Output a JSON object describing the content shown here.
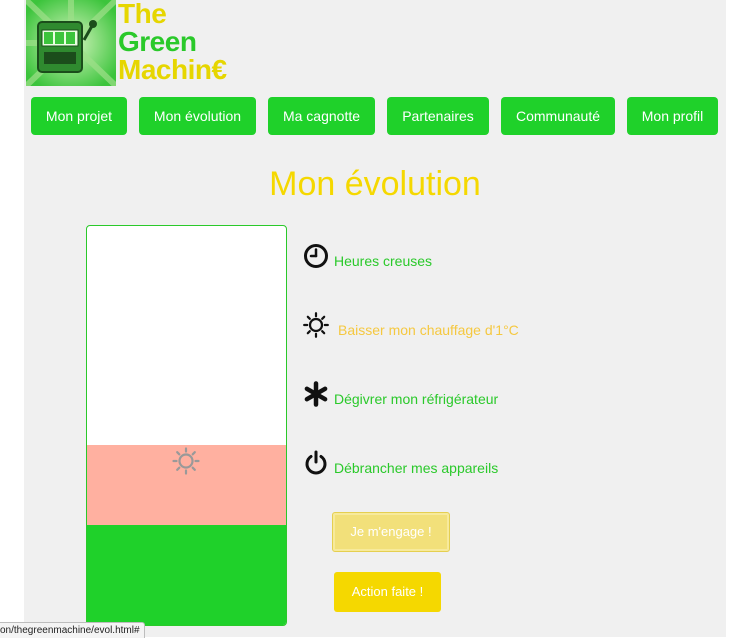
{
  "logo": {
    "line1": "The",
    "line2": "Green",
    "line3": "Machin€",
    "icon": "slot-machine-icon"
  },
  "nav": {
    "items": [
      {
        "label": "Mon projet"
      },
      {
        "label": "Mon évolution"
      },
      {
        "label": "Ma cagnotte"
      },
      {
        "label": "Partenaires"
      },
      {
        "label": "Communauté"
      },
      {
        "label": "Mon profil"
      }
    ]
  },
  "main": {
    "title": "Mon évolution"
  },
  "progress": {
    "achieved_fraction": 0.25,
    "pledged_fraction": 0.2,
    "colors": {
      "achieved": "#1fd12a",
      "pledged": "#ffb0a0",
      "empty": "#ffffff"
    },
    "pledged_icon": "sun-icon"
  },
  "actions": [
    {
      "label": "Heures creuses",
      "icon": "clock-icon",
      "selected": false
    },
    {
      "label": "Baisser mon chauffage d'1°C",
      "icon": "sun-icon",
      "selected": true
    },
    {
      "label": "Dégivrer mon réfrigérateur",
      "icon": "asterisk-icon",
      "selected": false
    },
    {
      "label": "Débrancher mes appareils",
      "icon": "power-icon",
      "selected": false
    }
  ],
  "buttons": {
    "engage": "Je m'engage !",
    "done": "Action faite !"
  },
  "status_bar": {
    "url": "on/thegreenmachine/evol.html#"
  },
  "colors": {
    "green": "#1fd12a",
    "yellow": "#f5d800",
    "selected_text": "#f5c840"
  }
}
